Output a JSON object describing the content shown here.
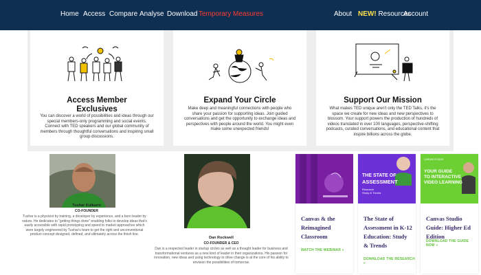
{
  "nav": {
    "left": [
      "Home",
      "Access",
      "Compare",
      "Analyse",
      "Download",
      "Temporary Measures"
    ],
    "active": "Temporary Measures",
    "about": "About",
    "resources_new": "NEW!",
    "resources": "Resources",
    "account": "Account"
  },
  "cards": [
    {
      "title_line1": "Access Member",
      "title_line2": "Exclusives",
      "body": "You can discover a world of possibilities and ideas through our special members-only programming and social events. Connect with TED speakers and our global community of members through thoughtful conversations and inspiring small group discussions."
    },
    {
      "title": "Expand Your Circle",
      "body": "Make deep and meaningful connections with people who share your passion for supporting ideas. Join guided conversations and get the opportunity to exchange ideas and perspectives with people around the world. You might even make some unexpected friends!"
    },
    {
      "title": "Support Our Mission",
      "body": "What makes TED unique aren't only the TED Talks, it's the space we create for new ideas and new perspectives to blossom. Your support powers the production of hundreds of videos translated in over 100 languages, perspective-shifting podcasts, curated conversations, and educational content that inspire billions across the globe."
    }
  ],
  "people": [
    {
      "name": "Tushar Kulkarni",
      "role": "CO-FOUNDER",
      "bio": "Tushar is a physicist by training, a developer by experience, and a born leader by nature. He dedicates to \"getting things done\" enabling folks to develop ideas that's easily accessible with rapid prototyping and speed to market approaches which were largely engineered by Tushar's team to get the right and unconventional product concept designed, defined, and ultimately across the finish line."
    },
    {
      "name": "Dan Rockwell",
      "role": "CO-FOUNDER & CEO",
      "bio": "Dan is a respected leader in startup circles as well as a thought leader for business and transformational ventures as a new kind of leader in their organizations. His passion for innovation, new ideas and using technology to drive change is at the core of his ability to envision the possibilities of tomorrow."
    }
  ],
  "resources": [
    {
      "title": "Canvas & the Reimagined Classroom",
      "link": "WATCH THE WEBINAR »",
      "thumb_color": "#7a1fa2"
    },
    {
      "title": "The State of Assessment in K-12 Education: Study & Trends",
      "link": "DOWNLOAD THE RESEARCH »",
      "thumb_color": "#6d2fd6",
      "thumb_text1": "THE STATE OF",
      "thumb_text2": "ASSESSMENT",
      "thumb_text3": "Research",
      "thumb_text4": "Study & Trends"
    },
    {
      "title": "Canvas Studio Guide: Higher Ed Edition",
      "link": "DOWNLOAD THE GUIDE NOW »",
      "thumb_color": "#6ccf34",
      "thumb_text1": "YOUR GUIDE",
      "thumb_text2": "TO INTERACTIVE",
      "thumb_text3": "VIDEO LEARNING",
      "thumb_badge": "CANVAS STUDIO"
    }
  ]
}
